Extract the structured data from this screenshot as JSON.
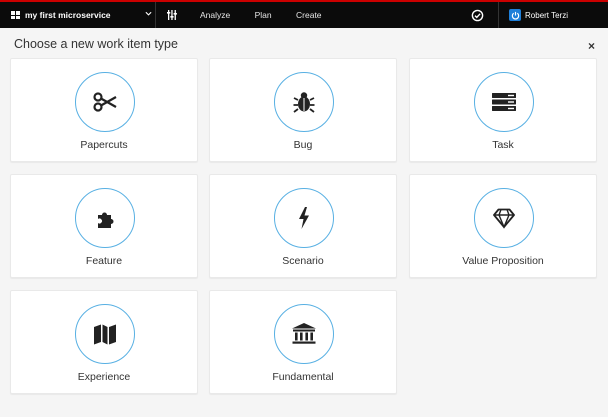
{
  "topbar": {
    "context_title": "my first microservice",
    "nav": [
      "Analyze",
      "Plan",
      "Create"
    ],
    "user_name": "Robert Terzi",
    "accent_color": "#cc0000"
  },
  "dialog": {
    "title": "Choose a new work item type",
    "close_glyph": "×"
  },
  "work_item_types": [
    {
      "label": "Papercuts",
      "icon": "scissors-icon"
    },
    {
      "label": "Bug",
      "icon": "bug-icon"
    },
    {
      "label": "Task",
      "icon": "server-stack-icon"
    },
    {
      "label": "Feature",
      "icon": "puzzle-icon"
    },
    {
      "label": "Scenario",
      "icon": "bolt-icon"
    },
    {
      "label": "Value Proposition",
      "icon": "diamond-icon"
    },
    {
      "label": "Experience",
      "icon": "map-icon"
    },
    {
      "label": "Fundamental",
      "icon": "institution-icon"
    }
  ],
  "circle_color": "#58b0e3"
}
